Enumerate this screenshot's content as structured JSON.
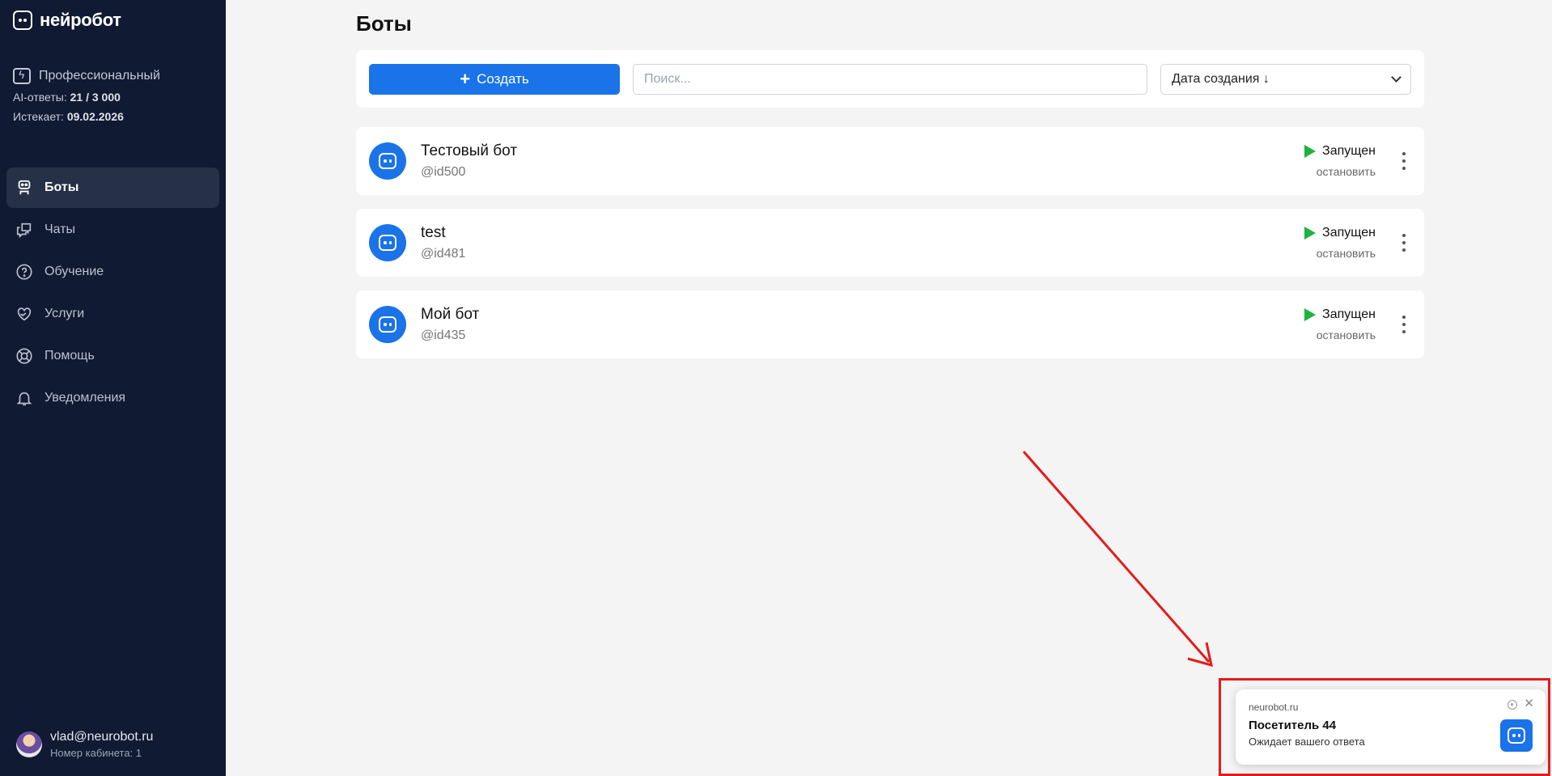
{
  "app": {
    "logo_text": "нейробот"
  },
  "plan": {
    "name": "Профессиональный",
    "ai_label": "AI-ответы:",
    "ai_value": "21 / 3 000",
    "expires_label": "Истекает:",
    "expires_value": "09.02.2026"
  },
  "nav": {
    "items": [
      {
        "label": "Боты",
        "icon": "robot-icon",
        "active": true
      },
      {
        "label": "Чаты",
        "icon": "chat-icon"
      },
      {
        "label": "Обучение",
        "icon": "question-icon"
      },
      {
        "label": "Услуги",
        "icon": "heart-hand-icon"
      },
      {
        "label": "Помощь",
        "icon": "lifebuoy-icon"
      },
      {
        "label": "Уведомления",
        "icon": "bell-icon"
      }
    ]
  },
  "user": {
    "email": "vlad@neurobot.ru",
    "cabinet": "Номер кабинета: 1"
  },
  "main": {
    "title": "Боты",
    "create_label": "Создать",
    "search_placeholder": "Поиск...",
    "sort_label": "Дата создания ↓"
  },
  "bots": [
    {
      "name": "Тестовый бот",
      "handle": "@id500",
      "status": "Запущен",
      "action": "остановить"
    },
    {
      "name": "test",
      "handle": "@id481",
      "status": "Запущен",
      "action": "остановить"
    },
    {
      "name": "Мой бот",
      "handle": "@id435",
      "status": "Запущен",
      "action": "остановить"
    }
  ],
  "notification": {
    "site": "neurobot.ru",
    "title": "Посетитель 44",
    "subtitle": "Ожидает вашего ответа"
  },
  "colors": {
    "sidebar_bg": "#101a33",
    "accent": "#1a73e8",
    "running": "#1db33f",
    "annotation": "#e51b1b"
  }
}
